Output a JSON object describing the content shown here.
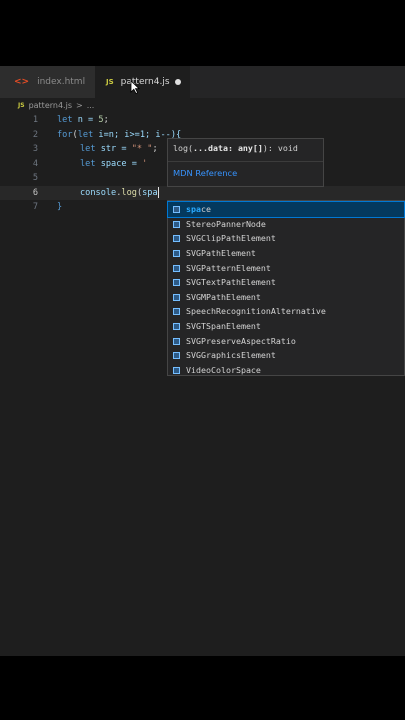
{
  "tabs": [
    {
      "label": "index.html",
      "icon": "html-icon"
    },
    {
      "label": "pattern4.js",
      "icon": "js-icon",
      "dirty": true
    }
  ],
  "breadcrumb": {
    "file": "pattern4.js",
    "sep": ">",
    "more": "..."
  },
  "code": {
    "lines": [
      {
        "n": "1"
      },
      {
        "n": "2"
      },
      {
        "n": "3"
      },
      {
        "n": "4"
      },
      {
        "n": "5"
      },
      {
        "n": "6"
      },
      {
        "n": "7"
      }
    ],
    "l1": {
      "kw": "let",
      "rest": " n = ",
      "num": "5",
      "end": ";"
    },
    "l2": {
      "kw": "for",
      "open": "(",
      "kw2": "let",
      "rest": " i=n; i>=1; i--){"
    },
    "l3": {
      "kw": "let",
      "var": " str = ",
      "str": "\"* \"",
      "end": ";"
    },
    "l4": {
      "kw": "let",
      "var": " space = ",
      "str": "'"
    },
    "l6": {
      "obj": "console",
      "dot": ".",
      "fn": "log",
      "open": "(",
      "typed": "spa"
    },
    "l7": {
      "close": "}"
    }
  },
  "hint": {
    "sig_pre": "log(",
    "sig_param": "...data: any[]",
    "sig_post": "): void",
    "link": "MDN Reference"
  },
  "suggestions": [
    {
      "match": "spa",
      "rest": "ce",
      "selected": true
    },
    {
      "label": "StereoPannerNode"
    },
    {
      "label": "SVGClipPathElement"
    },
    {
      "label": "SVGPathElement"
    },
    {
      "label": "SVGPatternElement"
    },
    {
      "label": "SVGTextPathElement"
    },
    {
      "label": "SVGMPathElement"
    },
    {
      "label": "SpeechRecognitionAlternative"
    },
    {
      "label": "SVGTSpanElement"
    },
    {
      "label": "SVGPreserveAspectRatio"
    },
    {
      "label": "SVGGraphicsElement"
    },
    {
      "label": "VideoColorSpace"
    }
  ],
  "colors": {
    "accent": "#0078d4",
    "selection": "#04395e",
    "link": "#3794ff"
  }
}
